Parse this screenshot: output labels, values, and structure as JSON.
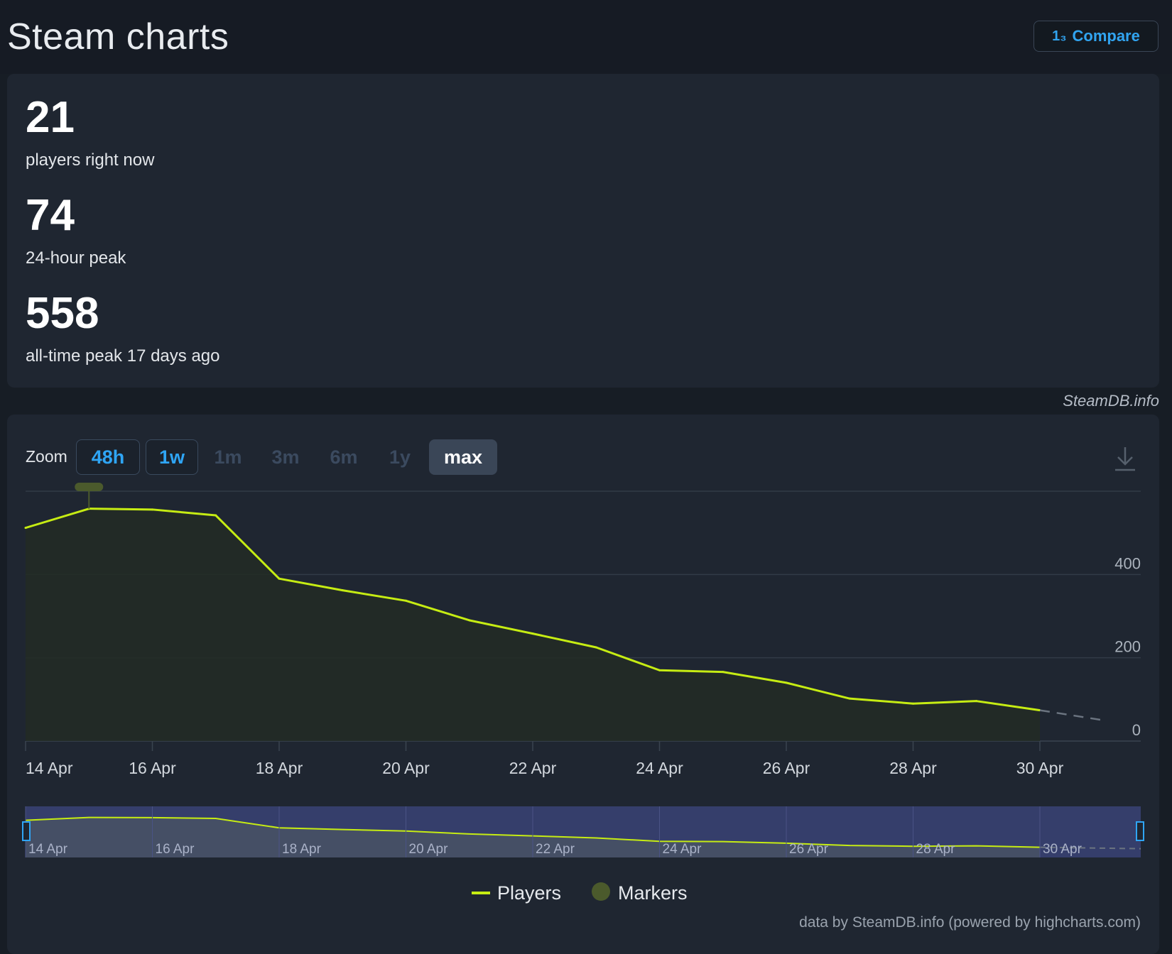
{
  "header": {
    "title": "Steam charts",
    "compare_label": "Compare",
    "compare_icon": "numbers-icon"
  },
  "stats": [
    {
      "value": "21",
      "label": "players right now"
    },
    {
      "value": "74",
      "label": "24-hour peak"
    },
    {
      "value": "558",
      "label": "all-time peak 17 days ago"
    }
  ],
  "source_credit": "SteamDB.info",
  "zoom": {
    "label": "Zoom",
    "buttons": [
      "48h",
      "1w",
      "1m",
      "3m",
      "6m",
      "1y",
      "max"
    ],
    "selected": "max"
  },
  "chart_footer": "data by SteamDB.info (powered by highcharts.com)",
  "colors": {
    "line": "#c6ec13",
    "marker": "#4b5a2c",
    "accent_blue": "#2fa5f5",
    "navigator_bg": "#353e6b"
  },
  "chart_data": {
    "type": "line",
    "x": [
      "14 Apr",
      "15 Apr",
      "16 Apr",
      "17 Apr",
      "18 Apr",
      "19 Apr",
      "20 Apr",
      "21 Apr",
      "22 Apr",
      "23 Apr",
      "24 Apr",
      "25 Apr",
      "26 Apr",
      "27 Apr",
      "28 Apr",
      "29 Apr",
      "30 Apr"
    ],
    "series": [
      {
        "name": "Players",
        "values": [
          512,
          558,
          556,
          542,
          390,
          362,
          337,
          290,
          258,
          225,
          170,
          166,
          140,
          102,
          90,
          96,
          74
        ]
      }
    ],
    "projected": {
      "x": [
        "30 Apr",
        "1 May"
      ],
      "values": [
        74,
        50
      ]
    },
    "x_tick_labels": [
      "14 Apr",
      "16 Apr",
      "18 Apr",
      "20 Apr",
      "22 Apr",
      "24 Apr",
      "26 Apr",
      "28 Apr",
      "30 Apr"
    ],
    "y_tick_labels": [
      "0",
      "200",
      "400"
    ],
    "ylim": [
      0,
      600
    ],
    "grid": true,
    "legend": {
      "items": [
        "Players",
        "Markers"
      ],
      "placement": "bottom-center"
    },
    "navigator_labels": [
      "14 Apr",
      "16 Apr",
      "18 Apr",
      "20 Apr",
      "22 Apr",
      "24 Apr",
      "26 Apr",
      "28 Apr",
      "30 Apr"
    ]
  }
}
